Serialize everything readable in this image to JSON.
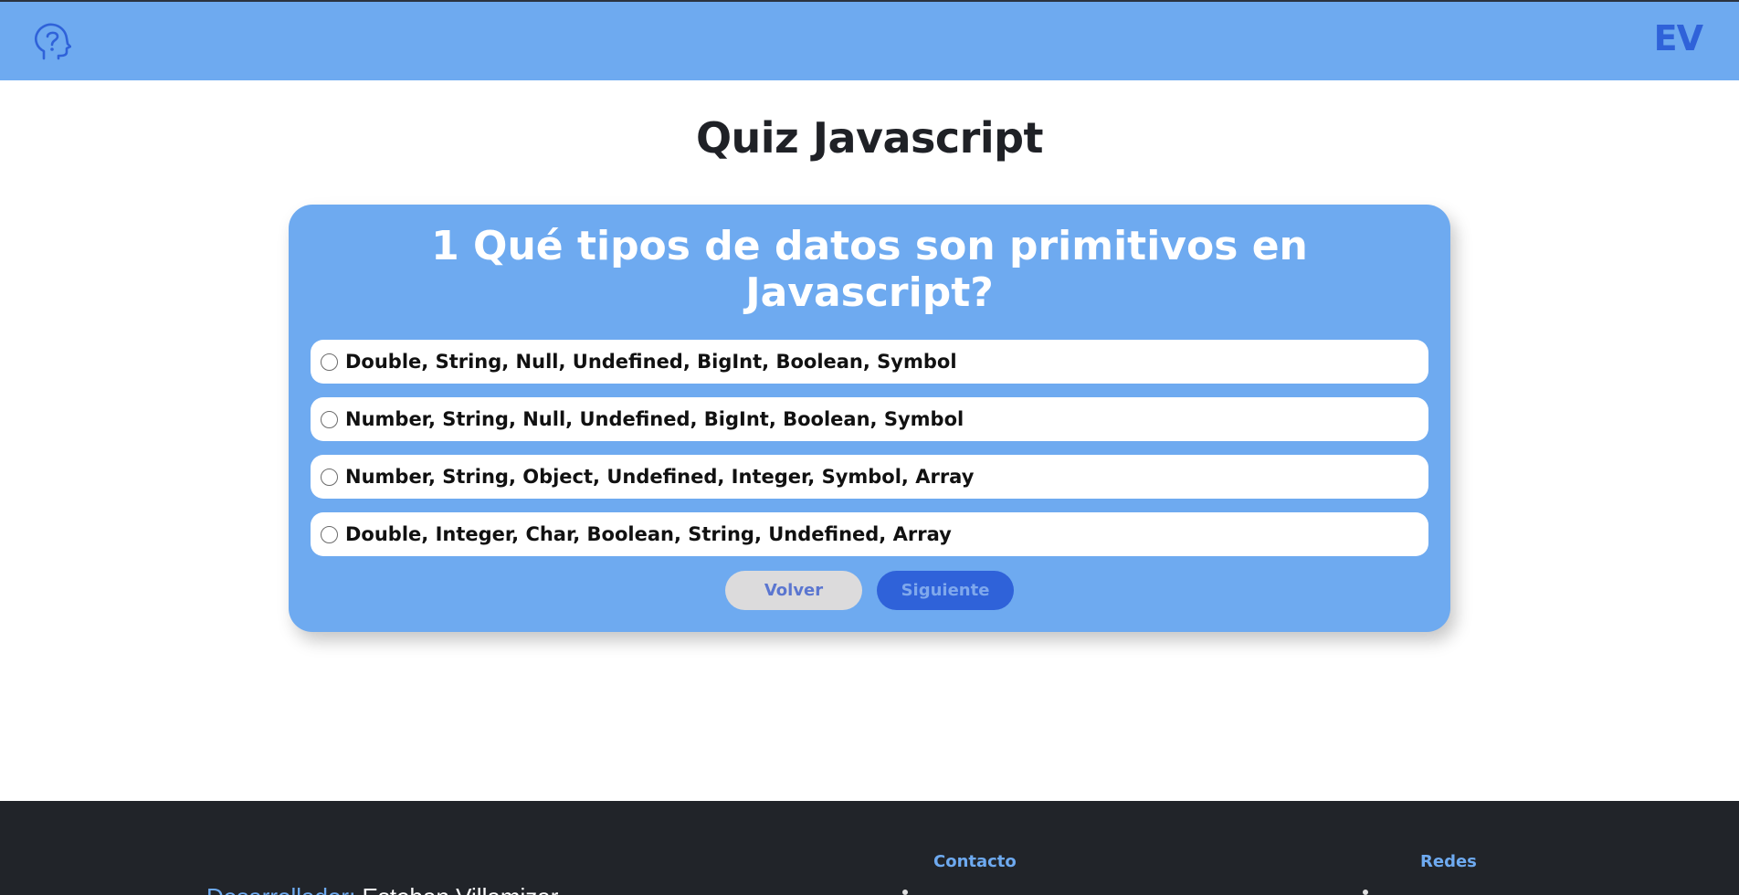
{
  "header": {
    "brand": "EV",
    "logo_icon": "head-question-icon",
    "colors": {
      "bar": "#6eaaf0",
      "brand": "#2f62d9"
    }
  },
  "page": {
    "title": "Quiz Javascript"
  },
  "quiz": {
    "question": "1 Qué tipos de datos son primitivos en Javascript?",
    "options": [
      "Double, String, Null, Undefined, BigInt, Boolean, Symbol",
      "Number, String, Null, Undefined, BigInt, Boolean, Symbol",
      "Number, String, Object, Undefined, Integer, Symbol, Array",
      "Double, Integer, Char, Boolean, String, Undefined, Array"
    ],
    "back_label": "Volver",
    "next_label": "Siguiente"
  },
  "footer": {
    "dev_label": "Desarrollador:",
    "dev_name": "Esteban Villamizar",
    "contact_heading": "Contacto",
    "social_heading": "Redes",
    "colors": {
      "background": "#212429",
      "accent": "#6eaaf0"
    }
  }
}
